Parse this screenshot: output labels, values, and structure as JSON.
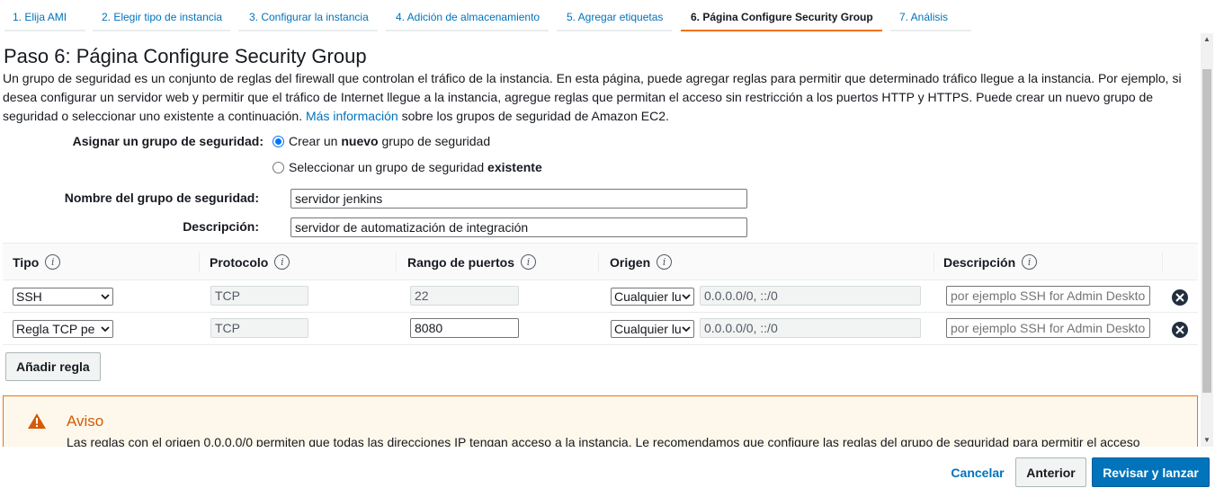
{
  "wizard": {
    "steps": [
      {
        "label": "1. Elija AMI",
        "active": false
      },
      {
        "label": "2. Elegir tipo de instancia",
        "active": false
      },
      {
        "label": "3. Configurar la instancia",
        "active": false
      },
      {
        "label": "4. Adición de almacenamiento",
        "active": false
      },
      {
        "label": "5. Agregar etiquetas",
        "active": false
      },
      {
        "label": "6. Página Configure Security Group",
        "active": true
      },
      {
        "label": "7. Análisis",
        "active": false
      }
    ]
  },
  "page": {
    "title": "Paso 6: Página Configure Security Group",
    "intro_text": "Un grupo de seguridad es un conjunto de reglas del firewall que controlan el tráfico de la instancia. En esta página, puede agregar reglas para permitir que determinado tráfico llegue a la instancia. Por ejemplo, si desea configurar un servidor web y permitir que el tráfico de Internet llegue a la instancia, agregue reglas que permitan el acceso sin restricción a los puertos HTTP y HTTPS. Puede crear un nuevo grupo de seguridad o seleccionar uno existente a continuación.",
    "more_info_link": "Más información",
    "intro_suffix": "sobre los grupos de seguridad de Amazon EC2."
  },
  "form": {
    "assign_label": "Asignar un grupo de seguridad:",
    "option_new": {
      "prefix": "Crear un ",
      "bold": "nuevo",
      "suffix": " grupo de seguridad",
      "checked": true
    },
    "option_existing": {
      "prefix": "Seleccionar un grupo de seguridad ",
      "bold": "existente",
      "checked": false
    },
    "name_label": "Nombre del grupo de seguridad:",
    "name_value": "servidor jenkins",
    "desc_label": "Descripción:",
    "desc_value": "servidor de automatización de integración"
  },
  "rules_table": {
    "columns": [
      "Tipo",
      "Protocolo",
      "Rango de puertos",
      "Origen",
      "Descripción"
    ],
    "info_glyph": "i",
    "rows": [
      {
        "type": "SSH",
        "protocol": "TCP",
        "port_range": "22",
        "port_editable": false,
        "source": "Cualquier lu",
        "cidr": "0.0.0.0/0, ::/0",
        "description_placeholder": "por ejemplo SSH for Admin Desktop"
      },
      {
        "type": "Regla TCP pe",
        "protocol": "TCP",
        "port_range": "8080",
        "port_editable": true,
        "source": "Cualquier lu",
        "cidr": "0.0.0.0/0, ::/0",
        "description_placeholder": "por ejemplo SSH for Admin Desktop"
      }
    ],
    "add_rule_label": "Añadir regla"
  },
  "warning": {
    "title": "Aviso",
    "text": "Las reglas con el origen 0.0.0.0/0 permiten que todas las direcciones IP tengan acceso a la instancia. Le recomendamos que configure las reglas del grupo de seguridad para permitir el acceso"
  },
  "footer": {
    "cancel_label": "Cancelar",
    "previous_label": "Anterior",
    "review_launch_label": "Revisar y lanzar"
  },
  "colors": {
    "link": "#0073bb",
    "active_tab_underline": "#ec7211",
    "warning_border": "#ec7211",
    "warning_bg": "#fef8ec",
    "primary_button": "#0073bb"
  }
}
